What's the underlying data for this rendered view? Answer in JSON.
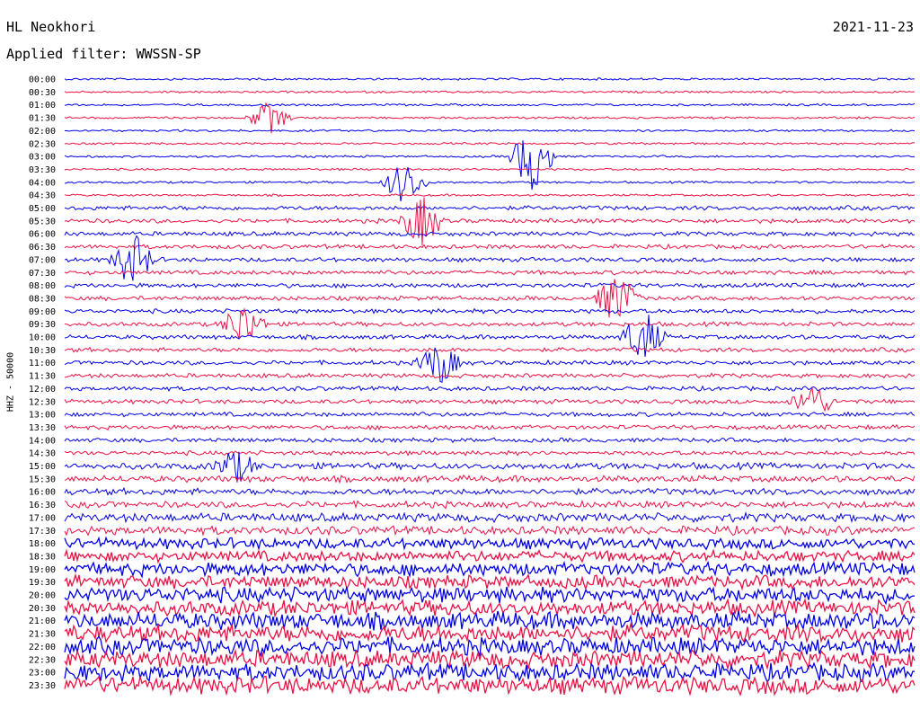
{
  "header": {
    "station": "HL Neokhori",
    "filter": "Applied filter: WWSSN-SP",
    "date": "2021-11-23",
    "channel": "HHZ - 50000"
  },
  "colors": {
    "line_a": "#0000ee",
    "line_b": "#ee1144"
  },
  "chart_data": {
    "type": "line",
    "title": "HL Neokhori",
    "ylabel": "HHZ - 50000",
    "row_labels": [
      "00:00",
      "00:30",
      "01:00",
      "01:30",
      "02:00",
      "02:30",
      "03:00",
      "03:30",
      "04:00",
      "04:30",
      "05:00",
      "05:30",
      "06:00",
      "06:30",
      "07:00",
      "07:30",
      "08:00",
      "08:30",
      "09:00",
      "09:30",
      "10:00",
      "10:30",
      "11:00",
      "11:30",
      "12:00",
      "12:30",
      "13:00",
      "13:30",
      "14:00",
      "14:30",
      "15:00",
      "15:30",
      "16:00",
      "16:30",
      "17:00",
      "17:30",
      "18:00",
      "18:30",
      "19:00",
      "19:30",
      "20:00",
      "20:30",
      "21:00",
      "21:30",
      "22:00",
      "22:30",
      "23:00",
      "23:30"
    ],
    "series_colors": [
      "blue",
      "red"
    ],
    "noise_level": [
      1,
      1,
      1,
      1,
      1,
      1,
      1,
      1,
      1,
      1,
      2,
      2,
      2,
      2,
      2,
      2,
      2,
      2,
      2,
      2,
      2,
      2,
      2,
      2,
      2,
      2,
      2,
      2,
      2,
      2,
      3,
      3,
      3,
      3,
      4,
      4,
      5,
      5,
      6,
      6,
      7,
      7,
      8,
      8,
      8,
      8,
      8,
      8
    ],
    "events": [
      {
        "row": 3,
        "x": 0.24,
        "amp": 18
      },
      {
        "row": 6,
        "x": 0.55,
        "amp": 40
      },
      {
        "row": 8,
        "x": 0.4,
        "amp": 25
      },
      {
        "row": 11,
        "x": 0.42,
        "amp": 28
      },
      {
        "row": 14,
        "x": 0.08,
        "amp": 30
      },
      {
        "row": 17,
        "x": 0.65,
        "amp": 30
      },
      {
        "row": 19,
        "x": 0.21,
        "amp": 25
      },
      {
        "row": 20,
        "x": 0.68,
        "amp": 30
      },
      {
        "row": 22,
        "x": 0.44,
        "amp": 25
      },
      {
        "row": 25,
        "x": 0.88,
        "amp": 20
      },
      {
        "row": 30,
        "x": 0.2,
        "amp": 18
      }
    ]
  }
}
